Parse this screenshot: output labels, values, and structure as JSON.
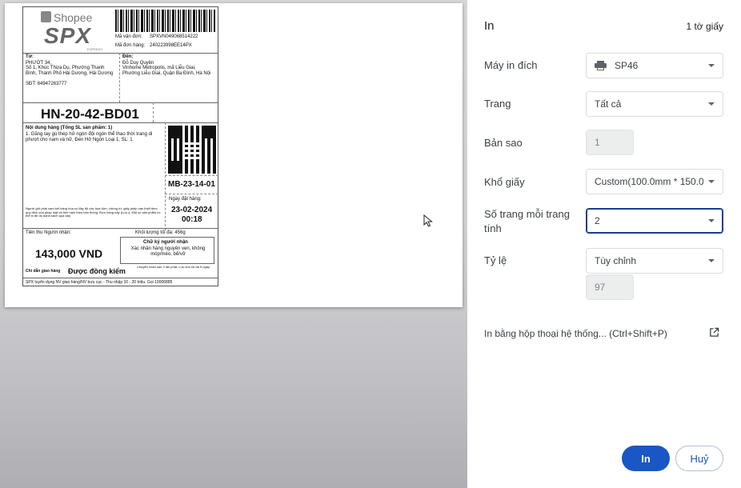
{
  "panel": {
    "title": "In",
    "sheet_count": "1 tờ giấy",
    "destination": {
      "label": "Máy in đích",
      "value": "SP46"
    },
    "pages": {
      "label": "Trang",
      "value": "Tất cả"
    },
    "copies": {
      "label": "Bản sao",
      "value": "1"
    },
    "paper_size": {
      "label": "Khổ giấy",
      "value": "Custom(100.0mm * 150.0mm)"
    },
    "pages_per_sheet": {
      "label_line1": "Số trang mỗi trang",
      "label_line2": "tính",
      "value": "2"
    },
    "scale": {
      "label": "Tỷ lệ",
      "value": "Tùy chỉnh",
      "custom_value": "97"
    },
    "system_dialog": "In bằng hộp thoại hệ thống... (Ctrl+Shift+P)",
    "print_button": "In",
    "cancel_button": "Huỷ"
  },
  "label": {
    "brand": "Shopee",
    "logo_text": "SPX",
    "logo_sub": "EXPRESS",
    "tracking_label": "Mã vận đơn:",
    "tracking_value": "SPXVN049068514222",
    "order_label": "Mã đơn hàng:",
    "order_value": "240223998EE14PX",
    "from_label": "Từ:",
    "from_name": "PHƯỚT 34,",
    "from_address": "Số 1, Khúc Thừa Dụ, Phường Thanh Bình, Thành Phố Hải Dương, Hải Dương",
    "from_phone": "SĐT: 84947263777",
    "to_label": "Đến:",
    "to_name": "Đỗ Duy Quyên",
    "to_address": "Vinhome Metropolis, mã Liễu Giai, Phường Liễu Giai, Quận Ba Đình, Hà Nội",
    "route_code": "HN-20-42-BD01",
    "contents_title": "Nội dung hàng (Tổng SL sản phẩm: 1)",
    "contents_item": "1. Găng tay gù thép hở ngón đội ngón thể thao thời trang di phượt cho nam và nữ, Đen Hở Ngón Loại 1, SL: 1",
    "sort_code": "MB-23-14-01",
    "disclaimer": "Người gửi phải cam kết hàng hóa có đầy đủ các hóa đơn, chứng từ, giấy phép cần thiết theo quy định của pháp luật và tính hàm theo bản thông. Đơn hàng này (Lưu ý: Một số sản phẩm có thể bị ẩn do danh sách quá dài)",
    "order_date_label": "Ngày đặt hàng:",
    "order_date": "23-02-2024",
    "order_time": "00:18",
    "cod_label": "Tiền thu Người nhận:",
    "cod_amount": "143,000 VND",
    "weight": "Khối lượng tối đa: 456g",
    "signature_title": "Chữ ký người nhận",
    "signature_note": "Xác nhận hàng nguyên vẹn, không móp/méo, bể/vỡ",
    "delivery_note_label": "Chỉ dẫn giao hàng",
    "delivery_note_value": "Được đồng kiểm",
    "return_note": "Chuyển hoàn sau 3 lần phát; Lưu kho tối đa 5 ngày",
    "footer": "SPX tuyển dụng NV giao hàng/NV bưu cục - Thu nhập 10 - 20 triệu. Gọi 19006885"
  }
}
